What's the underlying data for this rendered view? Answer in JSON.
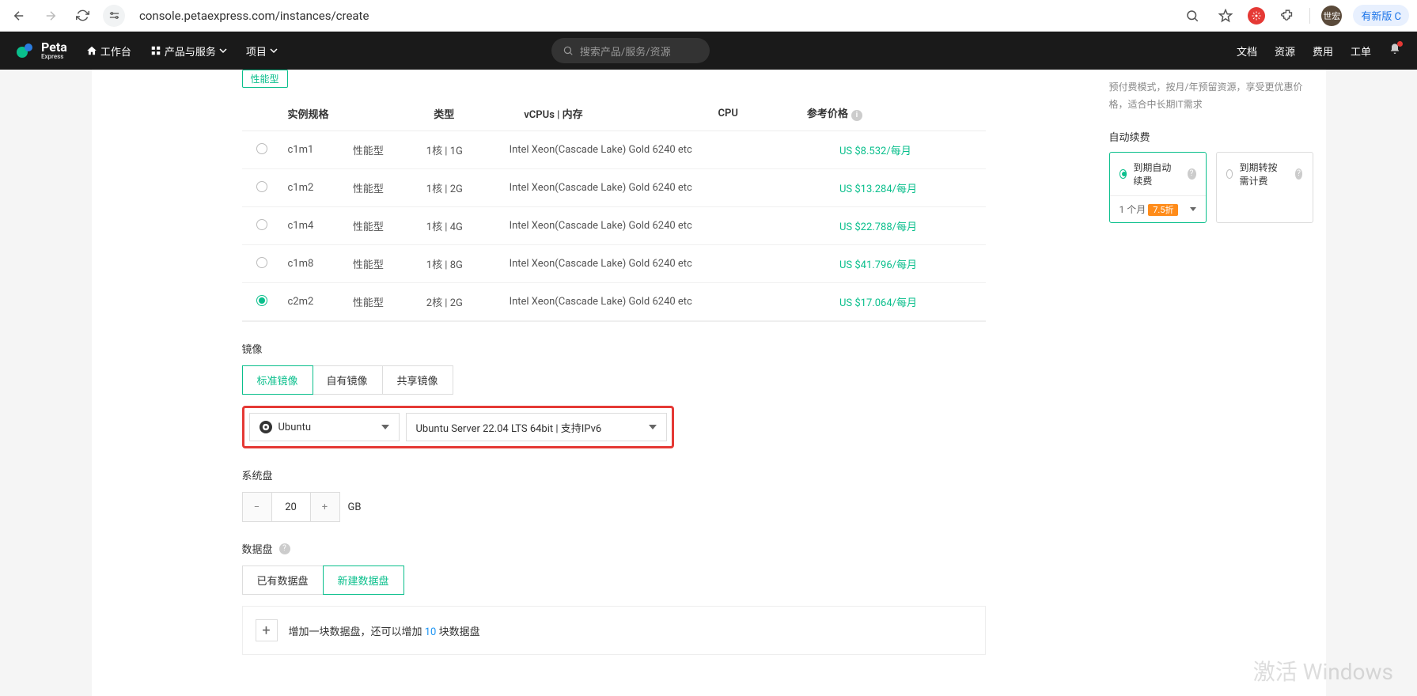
{
  "browser": {
    "url": "console.petaexpress.com/instances/create",
    "avatar": "世宏",
    "newVersion": "有新版 C"
  },
  "topbar": {
    "logoMain": "Peta",
    "logoSub": "Express",
    "workbench": "工作台",
    "products": "产品与服务",
    "project": "项目",
    "searchPlaceholder": "搜索产品/服务/资源",
    "docs": "文档",
    "resources": "资源",
    "fees": "费用",
    "tickets": "工单"
  },
  "perfTag": "性能型",
  "specTable": {
    "headers": {
      "spec": "实例规格",
      "type": "类型",
      "vcpu": "vCPUs | 内存",
      "cpu": "CPU",
      "price": "参考价格"
    },
    "rows": [
      {
        "spec": "c1m1",
        "type": "性能型",
        "vcpu": "1核 | 1G",
        "cpu": "Intel Xeon(Cascade Lake) Gold 6240 etc",
        "price": "US $8.532/每月",
        "selected": false
      },
      {
        "spec": "c1m2",
        "type": "性能型",
        "vcpu": "1核 | 2G",
        "cpu": "Intel Xeon(Cascade Lake) Gold 6240 etc",
        "price": "US $13.284/每月",
        "selected": false
      },
      {
        "spec": "c1m4",
        "type": "性能型",
        "vcpu": "1核 | 4G",
        "cpu": "Intel Xeon(Cascade Lake) Gold 6240 etc",
        "price": "US $22.788/每月",
        "selected": false
      },
      {
        "spec": "c1m8",
        "type": "性能型",
        "vcpu": "1核 | 8G",
        "cpu": "Intel Xeon(Cascade Lake) Gold 6240 etc",
        "price": "US $41.796/每月",
        "selected": false
      },
      {
        "spec": "c2m2",
        "type": "性能型",
        "vcpu": "2核 | 2G",
        "cpu": "Intel Xeon(Cascade Lake) Gold 6240 etc",
        "price": "US $17.064/每月",
        "selected": true
      }
    ]
  },
  "image": {
    "label": "镜像",
    "tabs": {
      "standard": "标准镜像",
      "own": "自有镜像",
      "shared": "共享镜像"
    },
    "os": "Ubuntu",
    "version": "Ubuntu Server 22.04 LTS 64bit | 支持IPv6"
  },
  "sysDisk": {
    "label": "系统盘",
    "value": "20",
    "unit": "GB"
  },
  "dataDisk": {
    "label": "数据盘",
    "tabs": {
      "existing": "已有数据盘",
      "new": "新建数据盘"
    },
    "addPrefix": "增加一块数据盘，还可以增加 ",
    "addCount": "10",
    "addSuffix": " 块数据盘"
  },
  "side": {
    "desc": "预付费模式，按月/年预留资源，享受更优惠价格，适合中长期IT需求",
    "renewLabel": "自动续费",
    "opt1": "到期自动续费",
    "opt2": "到期转按需计费",
    "period": "1 个月",
    "discount": "7.5折"
  },
  "watermark": "激活 Windows"
}
